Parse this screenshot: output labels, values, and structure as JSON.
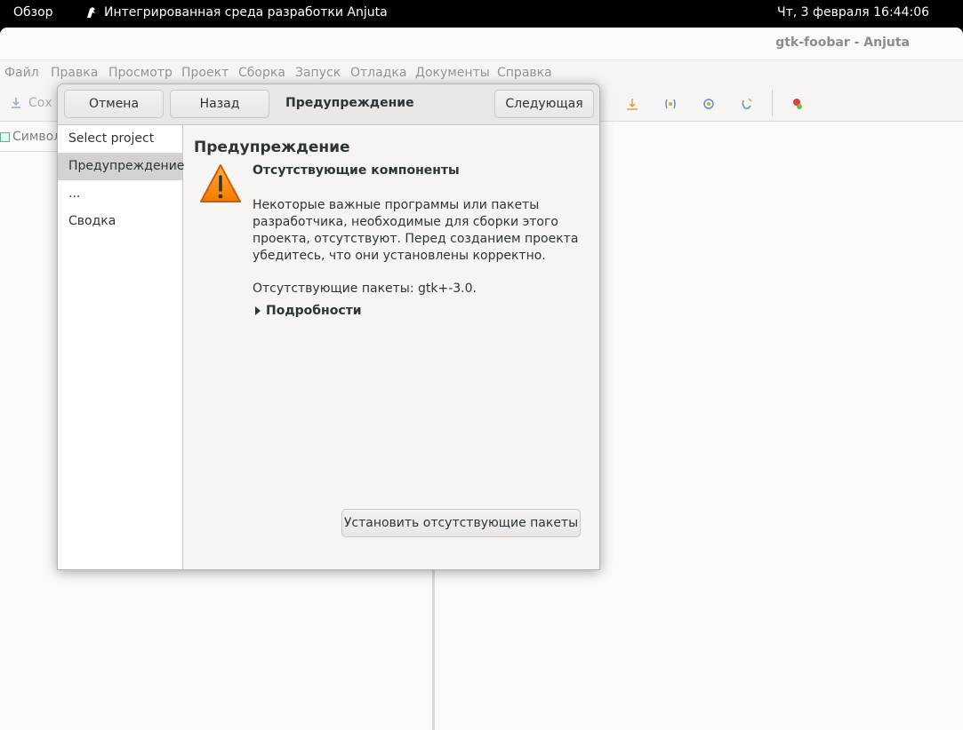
{
  "topbar": {
    "activities": "Обзор",
    "app_name": "Интегрированная среда разработки Anjuta",
    "clock": "Чт, 3 февраля  16:44:06"
  },
  "window": {
    "title": "gtk-foobar - Anjuta",
    "menu": [
      "Файл",
      "Правка",
      "Просмотр",
      "Проект",
      "Сборка",
      "Запуск",
      "Отладка",
      "Документы",
      "Справка"
    ],
    "toolbar_save": "Сох",
    "symbols_tab": "Символ"
  },
  "dialog": {
    "cancel_label": "Отмена",
    "back_label": "Назад",
    "title": "Предупреждение",
    "next_label": "Следующая",
    "steps": [
      "Select project",
      "Предупреждение",
      "...",
      "Сводка"
    ],
    "active_step": 1,
    "heading": "Предупреждение",
    "subheading": "Отсутствующие компоненты",
    "message": "Некоторые важные программы или пакеты разработчика, необходимые для сборки этого проекта, отсутствуют. Перед созданием проекта убедитесь, что они установлены корректно.",
    "missing_packages": "Отсутствующие пакеты: gtk+-3.0.",
    "details_label": "Подробности",
    "install_label": "Установить отсутствующие пакеты"
  },
  "colors": {
    "accent_warning": "#f57900",
    "topbar_bg": "#000000"
  }
}
